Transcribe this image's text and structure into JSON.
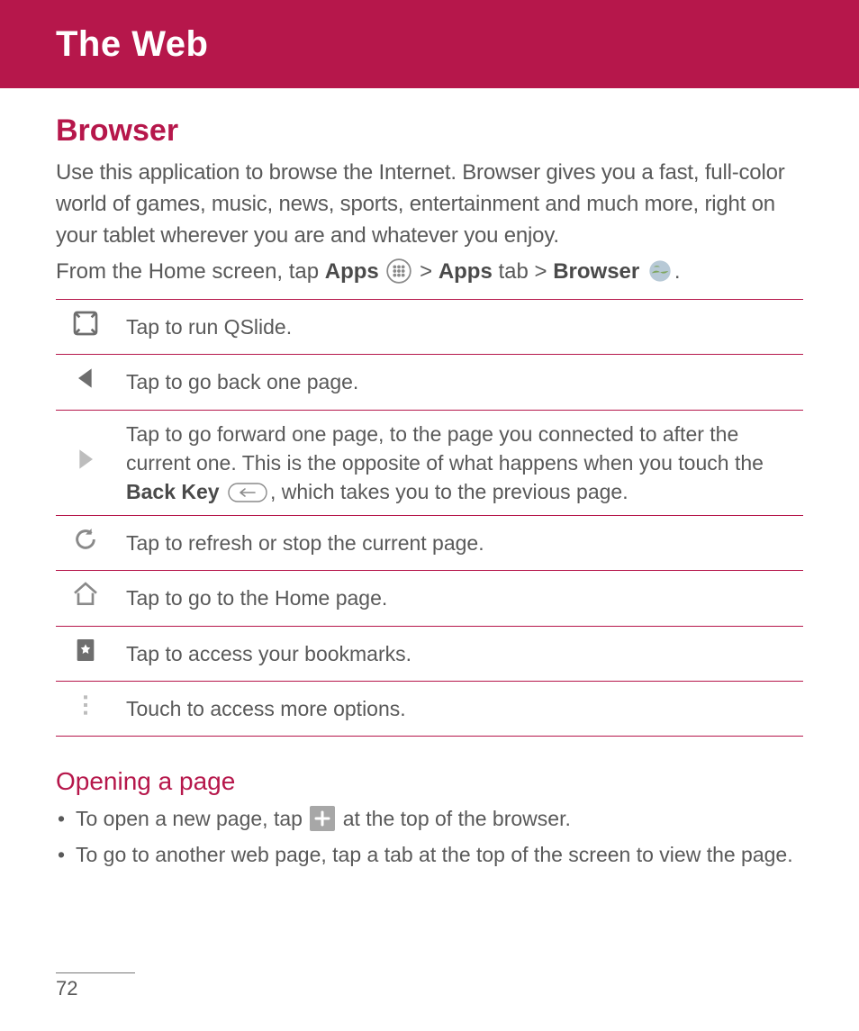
{
  "header": {
    "title": "The Web"
  },
  "section": {
    "title": "Browser",
    "intro": "Use this application to browse the Internet. Browser gives you a fast, full-color world of games, music, news, sports, entertainment and much more, right on your tablet wherever you are and whatever you enjoy.",
    "nav": {
      "prefix": "From the Home screen, tap ",
      "apps": "Apps",
      "sep1": " > ",
      "apps_tab": "Apps",
      "tab_word": " tab > ",
      "browser": "Browser",
      "period": "."
    }
  },
  "table": {
    "rows": [
      {
        "icon": "qslide-icon",
        "desc_plain": "Tap to run QSlide."
      },
      {
        "icon": "back-arrow-icon",
        "desc_plain": "Tap to go back one page."
      },
      {
        "icon": "forward-arrow-icon",
        "desc_pre": "Tap to go forward one page, to the page you connected to after the current one. This is the opposite of what happens when you touch the ",
        "desc_bold": "Back Key",
        "desc_post": ", which takes you to the previous page."
      },
      {
        "icon": "refresh-icon",
        "desc_plain": "Tap to refresh or stop the current page."
      },
      {
        "icon": "home-icon",
        "desc_plain": "Tap to go to the Home page."
      },
      {
        "icon": "bookmark-icon",
        "desc_plain": "Tap to access your bookmarks."
      },
      {
        "icon": "more-options-icon",
        "desc_plain": "Touch to access more options."
      }
    ]
  },
  "subsection": {
    "title": "Opening a page",
    "bullet1_pre": "To open a new page, tap ",
    "bullet1_post": " at the top of the browser.",
    "bullet2": "To go to another web page, tap a tab at the top of the screen to view the page."
  },
  "page_number": "72"
}
